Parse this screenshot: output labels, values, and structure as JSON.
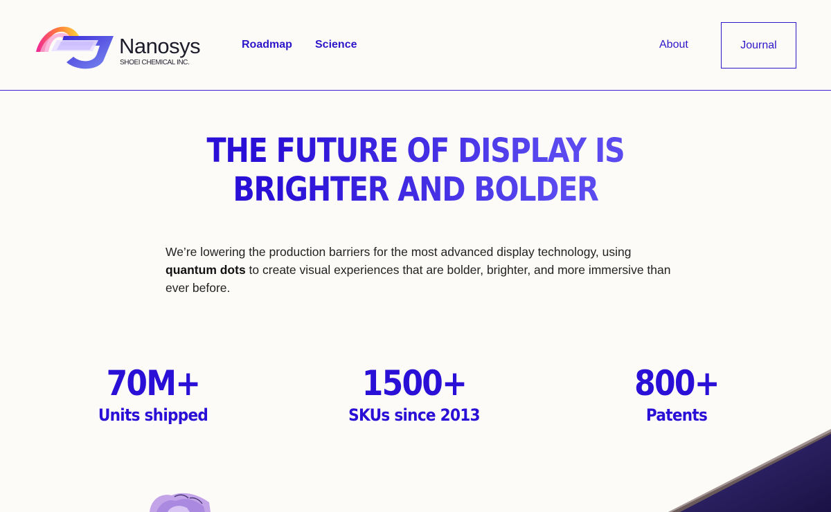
{
  "brand": {
    "name": "Nanosys",
    "subtitle": "SHOEI CHEMICAL INC."
  },
  "nav": {
    "roadmap": "Roadmap",
    "science": "Science",
    "about": "About",
    "journal": "Journal"
  },
  "hero": {
    "headline_line1": "THE FUTURE OF DISPLAY IS",
    "headline_line2": "BRIGHTER AND BOLDER",
    "intro_before": "We’re lowering the production barriers for the most advanced display technology, using ",
    "intro_bold": "quantum dots",
    "intro_after": " to create visual experiences that are bolder, brighter, and more immersive than ever before."
  },
  "stats": [
    {
      "value": "70M+",
      "label": "Units shipped"
    },
    {
      "value": "1500+",
      "label": "SKUs since 2013"
    },
    {
      "value": "800+",
      "label": "Patents"
    }
  ],
  "colors": {
    "accent": "#2b16c9",
    "background": "#fdfbf8"
  }
}
